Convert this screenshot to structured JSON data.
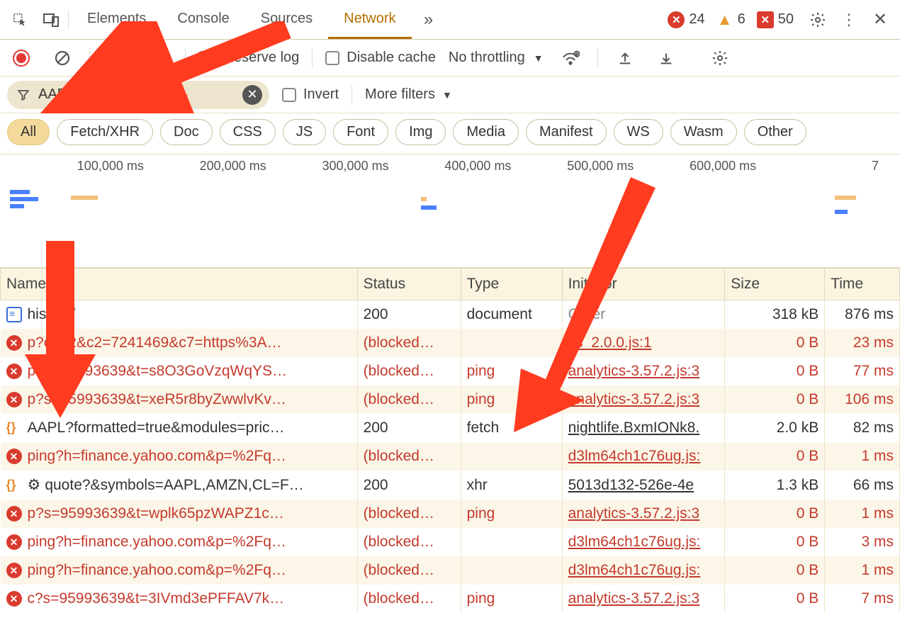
{
  "tabs": [
    "Elements",
    "Console",
    "Sources",
    "Network"
  ],
  "active_tab": "Network",
  "errors": {
    "red": 24,
    "warn": 6,
    "sq": 50
  },
  "toolbar": {
    "preserve": "Preserve log",
    "disable_cache": "Disable cache",
    "throttle": "No throttling"
  },
  "filter": {
    "value": "AAPL",
    "invert": "Invert",
    "more": "More filters"
  },
  "chips": [
    "All",
    "Fetch/XHR",
    "Doc",
    "CSS",
    "JS",
    "Font",
    "Img",
    "Media",
    "Manifest",
    "WS",
    "Wasm",
    "Other"
  ],
  "timeline_ticks": [
    "100,000 ms",
    "200,000 ms",
    "300,000 ms",
    "400,000 ms",
    "500,000 ms",
    "600,000 ms",
    "7"
  ],
  "columns": [
    "Name",
    "Status",
    "Type",
    "Initiator",
    "Size",
    "Time"
  ],
  "rows": [
    {
      "icon": "doc",
      "name": "history/",
      "status": "200",
      "type": "document",
      "initiator": "Other",
      "ilink": false,
      "size": "318 kB",
      "time": "876 ms",
      "blocked": false
    },
    {
      "icon": "err",
      "name": "p?c1=2&c2=7241469&c7=https%3A…",
      "status": "(blocked…",
      "type": "",
      "initiator": "cs_2.0.0.js:1",
      "ilink": true,
      "size": "0 B",
      "time": "23 ms",
      "blocked": true
    },
    {
      "icon": "err",
      "name": "p?s=95993639&t=s8O3GoVzqWqYS…",
      "status": "(blocked…",
      "type": "ping",
      "initiator": "analytics-3.57.2.js:3",
      "ilink": true,
      "size": "0 B",
      "time": "77 ms",
      "blocked": true
    },
    {
      "icon": "err",
      "name": "p?s=95993639&t=xeR5r8byZwwlvKv…",
      "status": "(blocked…",
      "type": "ping",
      "initiator": "analytics-3.57.2.js:3",
      "ilink": true,
      "size": "0 B",
      "time": "106 ms",
      "blocked": true
    },
    {
      "icon": "fetch",
      "name": "AAPL?formatted=true&modules=pric…",
      "status": "200",
      "type": "fetch",
      "initiator": "nightlife.BxmIONk8.",
      "ilink": false,
      "ul": true,
      "size": "2.0 kB",
      "time": "82 ms",
      "blocked": false
    },
    {
      "icon": "err",
      "name": "ping?h=finance.yahoo.com&p=%2Fq…",
      "status": "(blocked…",
      "type": "",
      "initiator": "d3lm64ch1c76ug.js:",
      "ilink": true,
      "size": "0 B",
      "time": "1 ms",
      "blocked": true
    },
    {
      "icon": "fetch",
      "name": "quote?&symbols=AAPL,AMZN,CL=F…",
      "gear": true,
      "status": "200",
      "type": "xhr",
      "initiator": "5013d132-526e-4e",
      "ilink": false,
      "ul": true,
      "size": "1.3 kB",
      "time": "66 ms",
      "blocked": false
    },
    {
      "icon": "err",
      "name": "p?s=95993639&t=wplk65pzWAPZ1c…",
      "status": "(blocked…",
      "type": "ping",
      "initiator": "analytics-3.57.2.js:3",
      "ilink": true,
      "size": "0 B",
      "time": "1 ms",
      "blocked": true
    },
    {
      "icon": "err",
      "name": "ping?h=finance.yahoo.com&p=%2Fq…",
      "status": "(blocked…",
      "type": "",
      "initiator": "d3lm64ch1c76ug.js:",
      "ilink": true,
      "size": "0 B",
      "time": "3 ms",
      "blocked": true
    },
    {
      "icon": "err",
      "name": "ping?h=finance.yahoo.com&p=%2Fq…",
      "status": "(blocked…",
      "type": "",
      "initiator": "d3lm64ch1c76ug.js:",
      "ilink": true,
      "size": "0 B",
      "time": "1 ms",
      "blocked": true
    },
    {
      "icon": "err",
      "name": "c?s=95993639&t=3IVmd3ePFFAV7k…",
      "status": "(blocked…",
      "type": "ping",
      "initiator": "analytics-3.57.2.js:3",
      "ilink": true,
      "size": "0 B",
      "time": "7 ms",
      "blocked": true
    }
  ]
}
